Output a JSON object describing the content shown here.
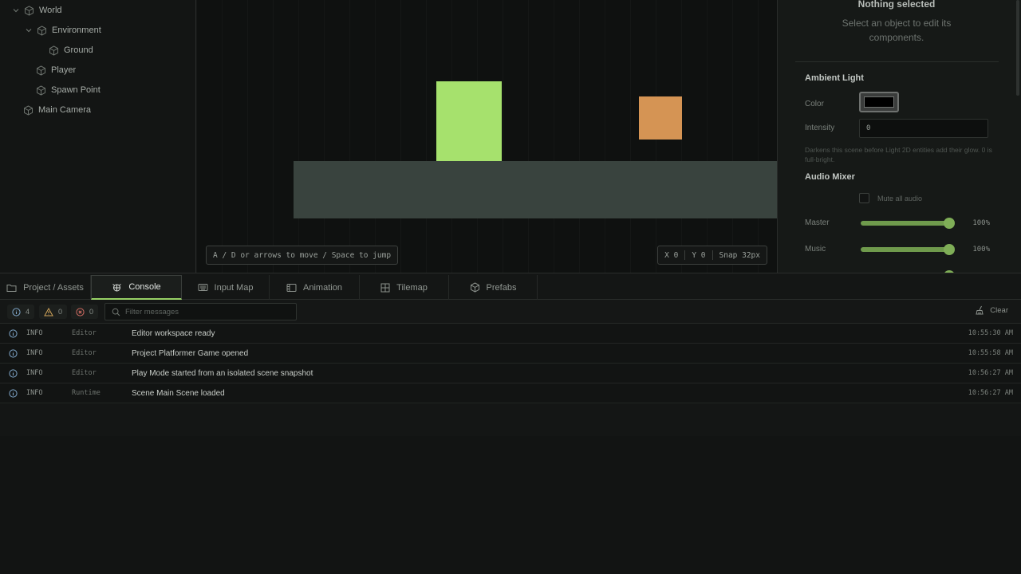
{
  "hierarchy": {
    "items": [
      {
        "label": "World",
        "expanded": true
      },
      {
        "label": "Environment",
        "expanded": true
      },
      {
        "label": "Ground"
      },
      {
        "label": "Player"
      },
      {
        "label": "Spawn Point"
      },
      {
        "label": "Main Camera"
      }
    ]
  },
  "viewport": {
    "hint": "A / D or arrows to move / Space to jump",
    "coord_x": "X 0",
    "coord_y": "Y 0",
    "snap": "Snap 32px",
    "colors": {
      "player": "#a6e16d",
      "box": "#d59454",
      "ground": "#39433e"
    }
  },
  "inspector": {
    "title": "Nothing selected",
    "subtitle": "Select an object to edit its components.",
    "ambient": {
      "title": "Ambient Light",
      "color_label": "Color",
      "color_value": "#000000",
      "intensity_label": "Intensity",
      "intensity_value": "0",
      "help": "Darkens this scene before Light 2D entities add their glow. 0 is full-bright."
    },
    "audio": {
      "title": "Audio Mixer",
      "mute_label": "Mute all audio",
      "mute_checked": false,
      "master_label": "Master",
      "master_value": "100%",
      "master_level": 1.0,
      "music_label": "Music",
      "music_value": "100%",
      "music_level": 1.0
    }
  },
  "tabs": [
    {
      "label": "Project / Assets",
      "icon": "folder-icon"
    },
    {
      "label": "Console",
      "icon": "bug-icon",
      "active": true
    },
    {
      "label": "Input Map",
      "icon": "keyboard-icon"
    },
    {
      "label": "Animation",
      "icon": "film-icon"
    },
    {
      "label": "Tilemap",
      "icon": "grid-icon"
    },
    {
      "label": "Prefabs",
      "icon": "cube-icon"
    }
  ],
  "console": {
    "counts": {
      "info": "4",
      "warn": "0",
      "error": "0"
    },
    "filter_placeholder": "Filter messages",
    "clear_label": "Clear",
    "logs": [
      {
        "level": "INFO",
        "source": "Editor",
        "message": "Editor workspace ready",
        "time": "10:55:30 AM"
      },
      {
        "level": "INFO",
        "source": "Editor",
        "message": "Project Platformer Game opened",
        "time": "10:55:58 AM"
      },
      {
        "level": "INFO",
        "source": "Editor",
        "message": "Play Mode started from an isolated scene snapshot",
        "time": "10:56:27 AM"
      },
      {
        "level": "INFO",
        "source": "Runtime",
        "message": "Scene Main Scene loaded",
        "time": "10:56:27 AM"
      }
    ]
  }
}
